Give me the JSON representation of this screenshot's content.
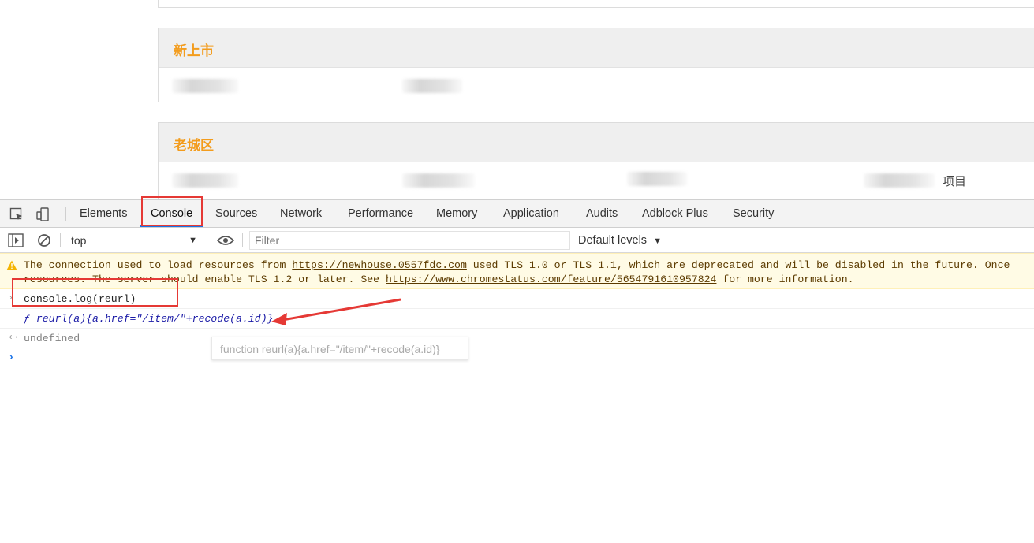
{
  "page": {
    "sections": [
      {
        "title": "新上市"
      },
      {
        "title": "老城区",
        "item_suffix": "项目"
      }
    ]
  },
  "devtools": {
    "tabs": [
      "Elements",
      "Console",
      "Sources",
      "Network",
      "Performance",
      "Memory",
      "Application",
      "Audits",
      "Adblock Plus",
      "Security"
    ],
    "active_tab": "Console",
    "context": "top",
    "filter_placeholder": "Filter",
    "levels_label": "Default levels",
    "warning": {
      "line1_pre": "The connection used to load resources from ",
      "line1_link": "https://newhouse.0557fdc.com",
      "line1_post": " used TLS 1.0 or TLS 1.1, which are deprecated and will be disabled in the future. Once",
      "line2_pre": "resources. The server should enable TLS 1.2 or later. See ",
      "line2_link": "https://www.chromestatus.com/feature/5654791610957824",
      "line2_post": " for more information."
    },
    "console_input": "console.log(reurl)",
    "console_output": "ƒ reurl(a){a.href=\"/item/\"+recode(a.id)}",
    "console_result": "undefined",
    "tooltip": "function reurl(a){a.href=\"/item/\"+recode(a.id)}"
  },
  "colors": {
    "section_title": "#f39c1d",
    "annotation_red": "#e53935",
    "active_tab_underline": "#1a73e8",
    "warning_bg": "#fffbe5"
  }
}
